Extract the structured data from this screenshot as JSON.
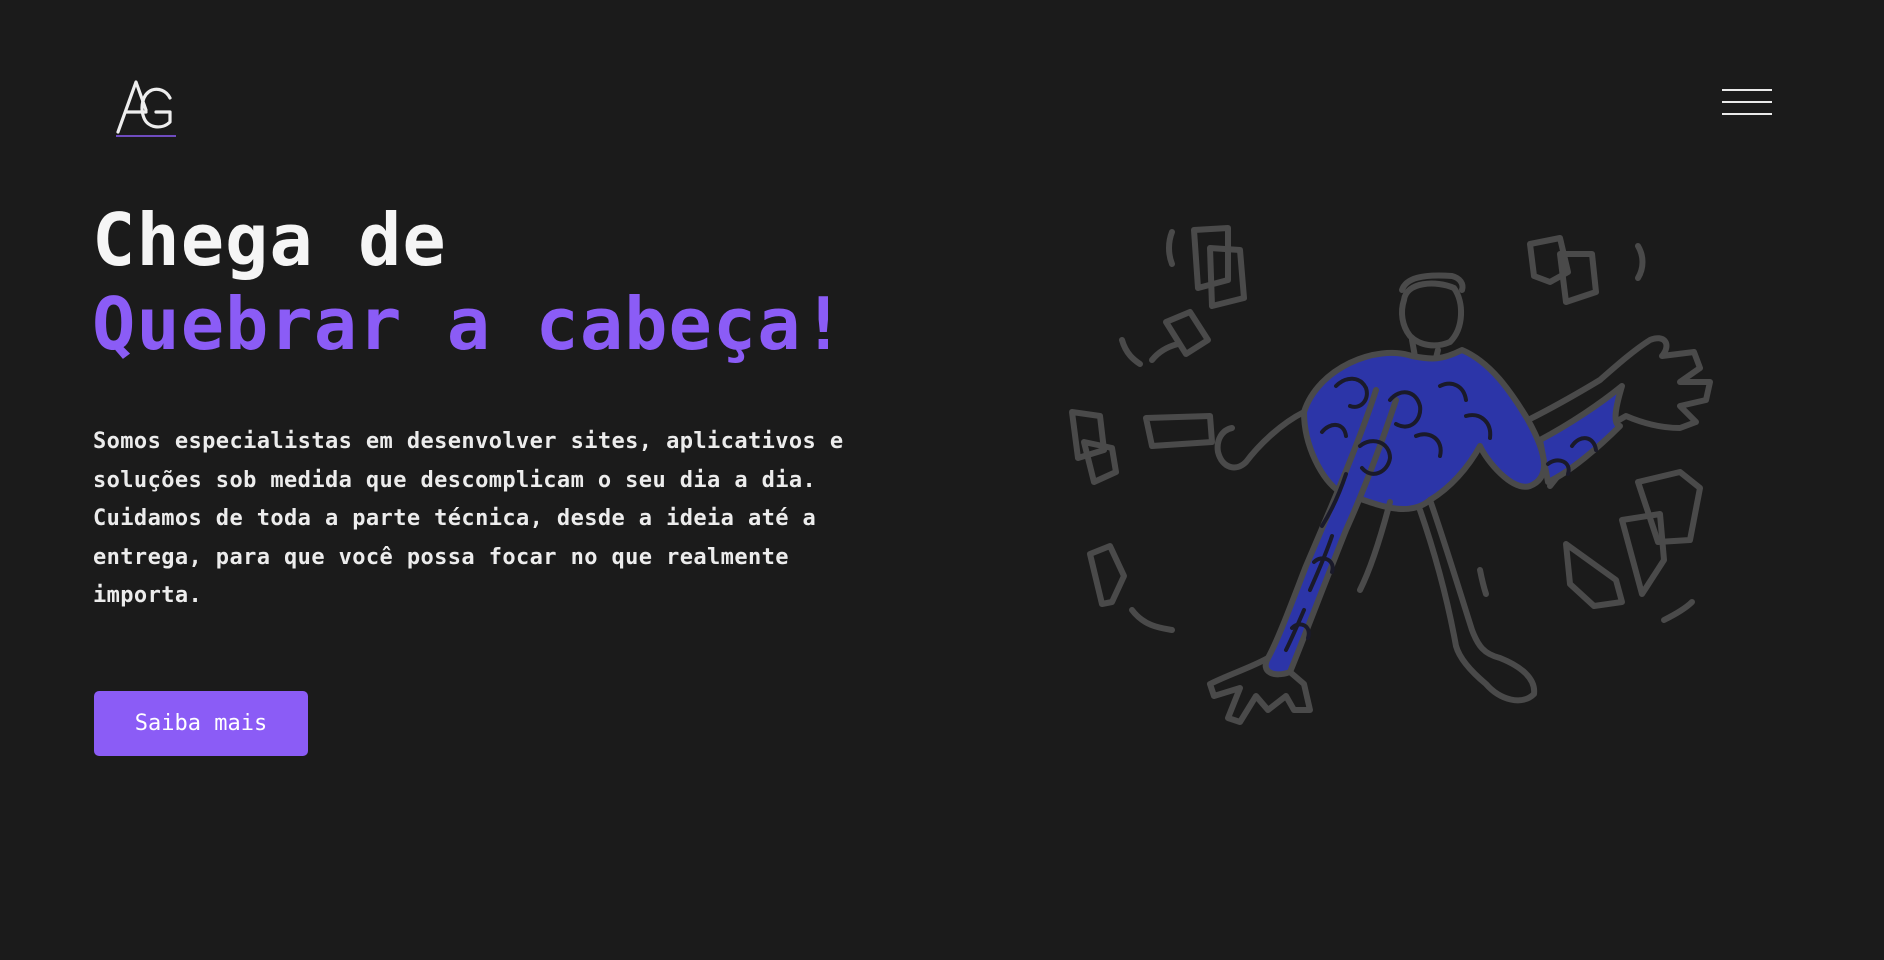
{
  "header": {
    "logo_icon": "ag-monogram-logo",
    "menu_icon": "hamburger-menu-icon"
  },
  "hero": {
    "title_line1": "Chega de",
    "title_line2": "Quebrar a cabeça!",
    "description": "Somos especialistas em desenvolver sites, aplicativos e soluções sob medida que descomplicam o seu dia a dia. Cuidamos de toda a parte técnica, desde a ideia até a entrega, para que você possa focar no que realmente importa.",
    "cta_label": "Saiba mais",
    "illustration_icon": "stressed-person-flying-papers-illustration"
  },
  "colors": {
    "background": "#1b1b1b",
    "accent": "#8b5cf6",
    "text": "#f5f5f5",
    "illustration_stroke": "#4a4a4a",
    "illustration_fill": "#2c35a8"
  }
}
